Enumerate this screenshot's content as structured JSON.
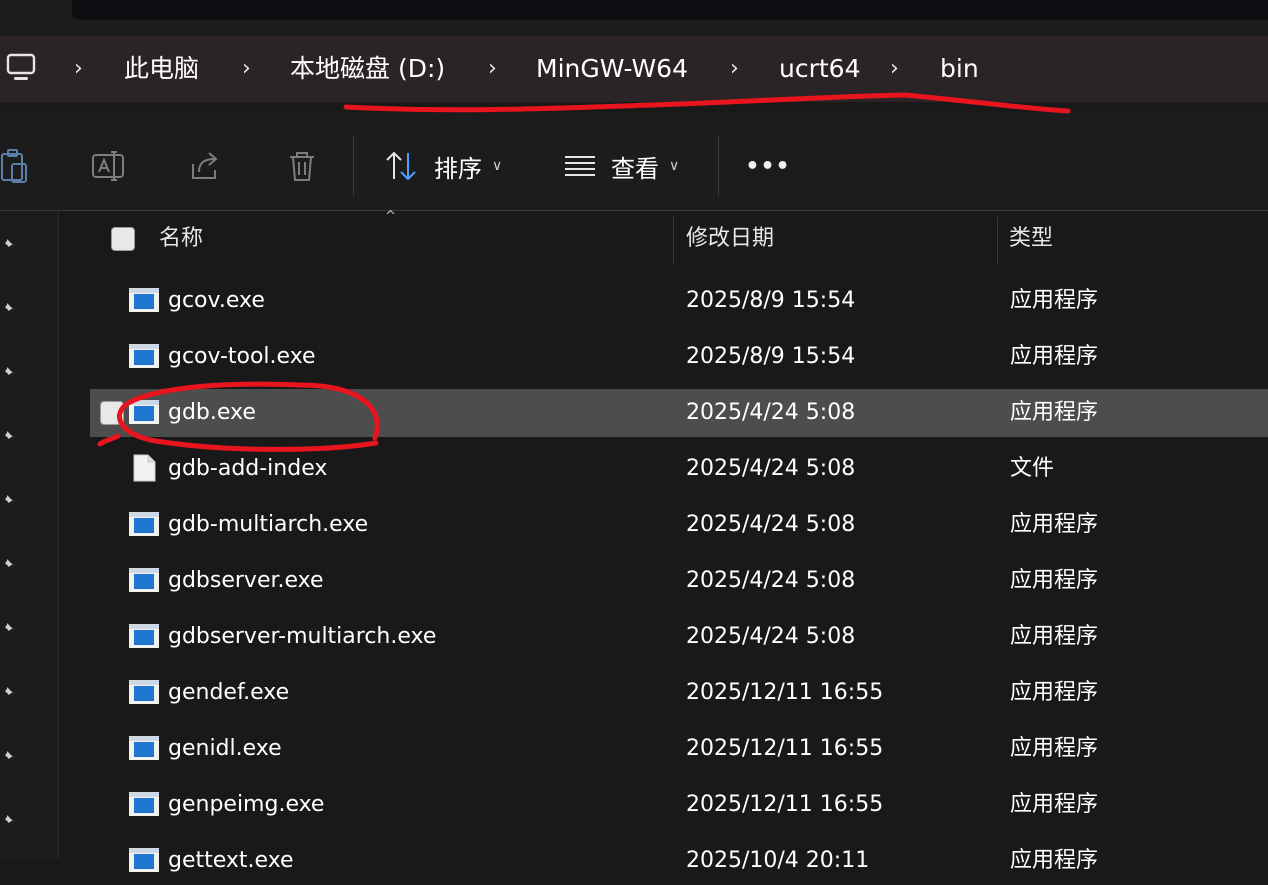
{
  "breadcrumb": [
    "此电脑",
    "本地磁盘 (D:)",
    "MinGW-W64",
    "ucrt64",
    "bin"
  ],
  "toolbar": {
    "sort_label": "排序",
    "view_label": "查看",
    "more_label": "•••"
  },
  "columns": {
    "name": "名称",
    "date": "修改日期",
    "type": "类型"
  },
  "files": [
    {
      "name": "gcov.exe",
      "date": "2025/8/9 15:54",
      "type": "应用程序",
      "icon": "exe-icon"
    },
    {
      "name": "gcov-tool.exe",
      "date": "2025/8/9 15:54",
      "type": "应用程序",
      "icon": "exe-icon"
    },
    {
      "name": "gdb.exe",
      "date": "2025/4/24 5:08",
      "type": "应用程序",
      "icon": "exe-icon",
      "selected": true
    },
    {
      "name": "gdb-add-index",
      "date": "2025/4/24 5:08",
      "type": "文件",
      "icon": "file-icon"
    },
    {
      "name": "gdb-multiarch.exe",
      "date": "2025/4/24 5:08",
      "type": "应用程序",
      "icon": "exe-icon"
    },
    {
      "name": "gdbserver.exe",
      "date": "2025/4/24 5:08",
      "type": "应用程序",
      "icon": "exe-icon"
    },
    {
      "name": "gdbserver-multiarch.exe",
      "date": "2025/4/24 5:08",
      "type": "应用程序",
      "icon": "exe-icon"
    },
    {
      "name": "gendef.exe",
      "date": "2025/12/11 16:55",
      "type": "应用程序",
      "icon": "exe-icon"
    },
    {
      "name": "genidl.exe",
      "date": "2025/12/11 16:55",
      "type": "应用程序",
      "icon": "exe-icon"
    },
    {
      "name": "genpeimg.exe",
      "date": "2025/12/11 16:55",
      "type": "应用程序",
      "icon": "exe-icon"
    },
    {
      "name": "gettext.exe",
      "date": "2025/10/4 20:11",
      "type": "应用程序",
      "icon": "exe-icon"
    }
  ],
  "colors": {
    "background": "#191919",
    "selection": "#4d4d4d",
    "annotation": "#e8141e",
    "exe_blue": "#1e78d2"
  }
}
